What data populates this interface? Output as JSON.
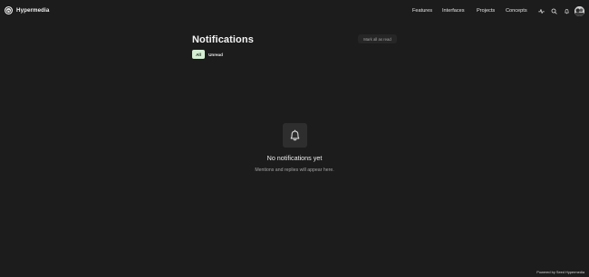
{
  "brand": {
    "name": "Hypermedia"
  },
  "nav": {
    "items": [
      "Features",
      "Interfaces",
      "Projects",
      "Concepts"
    ]
  },
  "header_icons": [
    "activity-icon",
    "search-icon",
    "bell-icon",
    "avatar"
  ],
  "page": {
    "title": "Notifications",
    "mark_all_label": "Mark all as read",
    "tabs": [
      {
        "label": "All",
        "selected": true
      },
      {
        "label": "Unread",
        "selected": false
      }
    ]
  },
  "empty_state": {
    "icon": "bell-icon",
    "title": "No notifications yet",
    "subtitle": "Mentions and replies will appear here."
  },
  "footer": {
    "text": "Powered by Seed Hypermedia"
  },
  "colors": {
    "background": "#1c1c1c",
    "tab_selected_bg": "#d4efd4",
    "empty_icon_bg": "#2e2e2e"
  }
}
